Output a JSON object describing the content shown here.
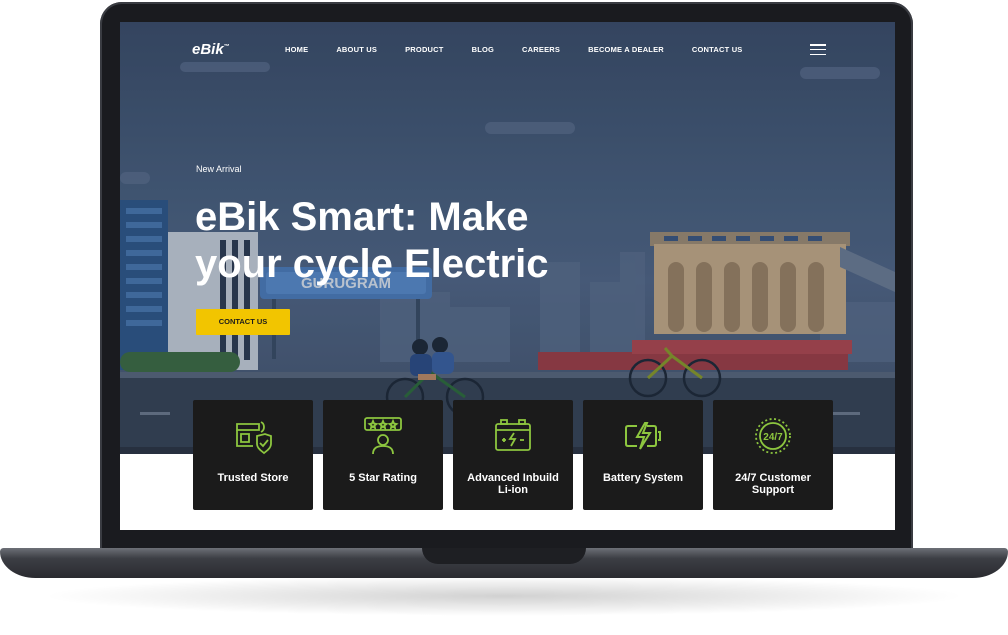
{
  "site": {
    "logo_text": "eBik",
    "logo_tm": "™"
  },
  "nav": {
    "items": [
      {
        "label": "HOME"
      },
      {
        "label": "ABOUT US"
      },
      {
        "label": "PRODUCT"
      },
      {
        "label": "BLOG"
      },
      {
        "label": "CAREERS"
      },
      {
        "label": "BECOME A DEALER"
      },
      {
        "label": "CONTACT US"
      }
    ],
    "menu_icon": "hamburger-icon"
  },
  "hero": {
    "badge": "New Arrival",
    "headline_line1": "eBik Smart: Make",
    "headline_line2": "your cycle Electric",
    "cta_label": "CONTACT US",
    "sign_text": "GURUGRAM"
  },
  "features": [
    {
      "label": "Trusted Store",
      "icon": "store-shield-icon"
    },
    {
      "label": "5 Star Rating",
      "icon": "rating-person-icon"
    },
    {
      "label": "Advanced Inbuild Li-ion",
      "icon": "battery-icon"
    },
    {
      "label": "Battery System",
      "icon": "charging-battery-icon"
    },
    {
      "label": "24/7 Customer Support",
      "icon": "support-247-icon"
    }
  ],
  "colors": {
    "accent": "#f2c500",
    "icon_green": "#8dc63f",
    "card_bg": "#1b1b1b",
    "hero_bg": "#4a6282"
  }
}
